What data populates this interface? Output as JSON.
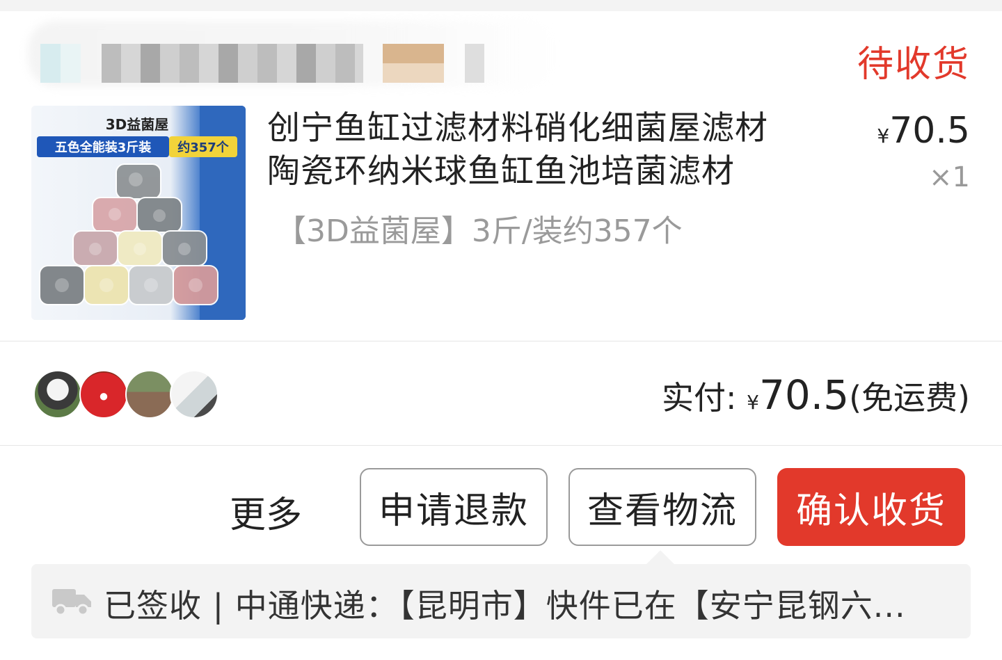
{
  "order": {
    "status": "待收货"
  },
  "product": {
    "image_badge_top": "3D益菌屋",
    "image_badge_left": "五色全能装3斤装",
    "image_badge_right": "约357个",
    "title_line1": "创宁鱼缸过滤材料硝化细菌屋滤材",
    "title_line2": "陶瓷环纳米球鱼缸鱼池培菌滤材",
    "spec": "【3D益菌屋】3斤/装约357个",
    "price_symbol": "¥",
    "price": "70.5",
    "quantity": "×1"
  },
  "summary": {
    "paid_label": "实付:",
    "currency": "¥",
    "amount": "70.5",
    "shipping_note": "(免运费)"
  },
  "actions": {
    "more": "更多",
    "refund": "申请退款",
    "logistics": "查看物流",
    "confirm": "确认收货"
  },
  "logistics": {
    "icon": "truck-icon",
    "text": "已签收 | 中通快递：【昆明市】快件已在【安宁昆钢六..."
  },
  "colors": {
    "accent": "#e2392b",
    "muted": "#9a9a9a",
    "panel": "#f3f3f3"
  }
}
